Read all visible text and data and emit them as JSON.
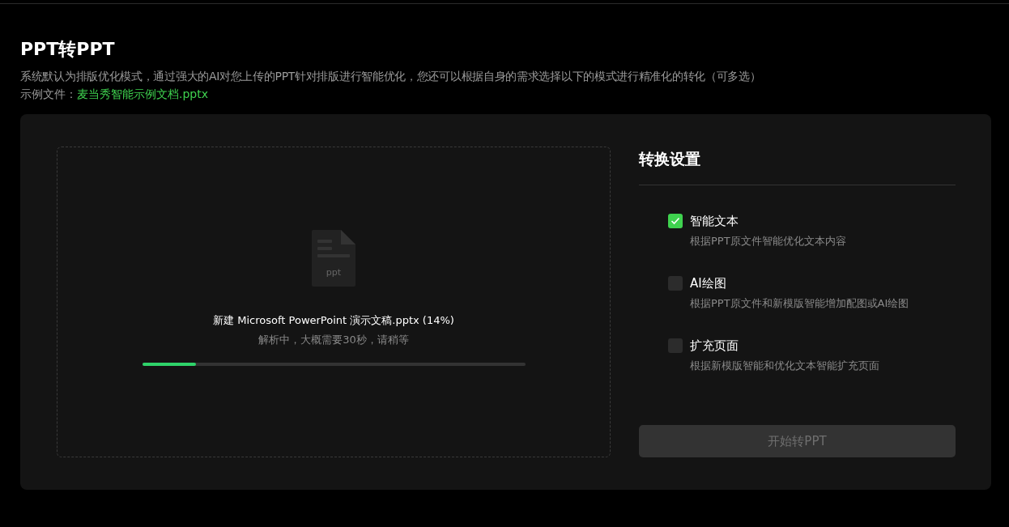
{
  "header": {
    "title": "PPT转PPT",
    "description": "系统默认为排版优化模式，通过强大的AI对您上传的PPT针对排版进行智能优化，您还可以根据自身的需求选择以下的模式进行精准化的转化（可多选）",
    "sample_label": "示例文件：",
    "sample_link": "麦当秀智能示例文档.pptx"
  },
  "upload": {
    "file_type": "ppt",
    "file_name": "新建 Microsoft PowerPoint 演示文稿.pptx (14%)",
    "status": "解析中，大概需要30秒，请稍等",
    "level": 0.14
  },
  "settings": {
    "title": "转换设置",
    "options": [
      {
        "label": "智能文本",
        "description": "根据PPT原文件智能优化文本内容",
        "checked": true
      },
      {
        "label": "AI绘图",
        "description": "根据PPT原文件和新模版智能增加配图或AI绘图",
        "checked": false
      },
      {
        "label": "扩充页面",
        "description": "根据新模版智能和优化文本智能扩充页面",
        "checked": false
      }
    ],
    "start_button": {
      "label": "开始转PPT",
      "disabled": true
    }
  }
}
